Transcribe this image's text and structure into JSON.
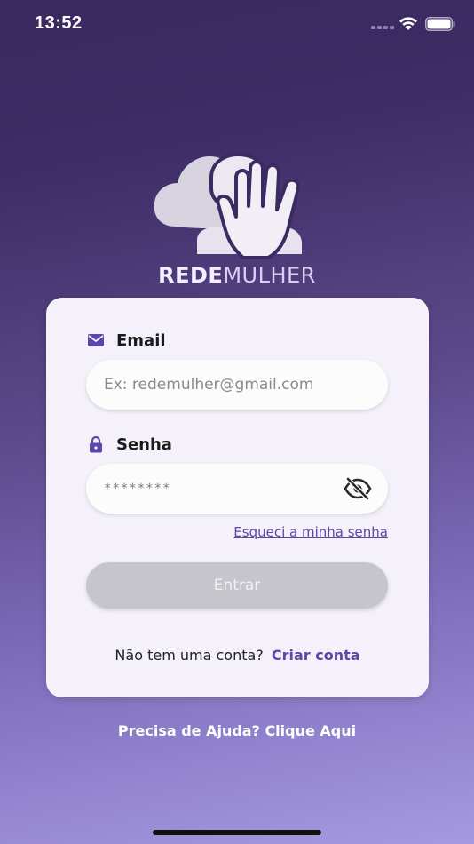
{
  "status_bar": {
    "time": "13:52",
    "icons": [
      "signal-icon",
      "wifi-icon",
      "battery-icon"
    ]
  },
  "brand": {
    "name_part1": "REDE",
    "name_part2": "MULHER",
    "logo_icon": "chat-bubbles-hand-logo"
  },
  "login_form": {
    "email": {
      "label": "Email",
      "icon": "envelope-icon",
      "placeholder": "Ex: redemulher@gmail.com",
      "value": ""
    },
    "password": {
      "label": "Senha",
      "icon": "lock-icon",
      "value_masked": "********",
      "toggle_icon": "eye-off-icon"
    },
    "forgot_password": "Esqueci a minha senha",
    "submit_label": "Entrar",
    "signup_prompt": "Não tem uma conta?",
    "signup_link": "Criar conta"
  },
  "help_text": "Precisa de Ajuda? Clique Aqui",
  "colors": {
    "accent": "#5a48a8",
    "card_bg": "#f4f1fa",
    "button_disabled": "#c7c5cc",
    "gradient_top": "#3a2860",
    "gradient_bottom": "#a59ae0"
  }
}
